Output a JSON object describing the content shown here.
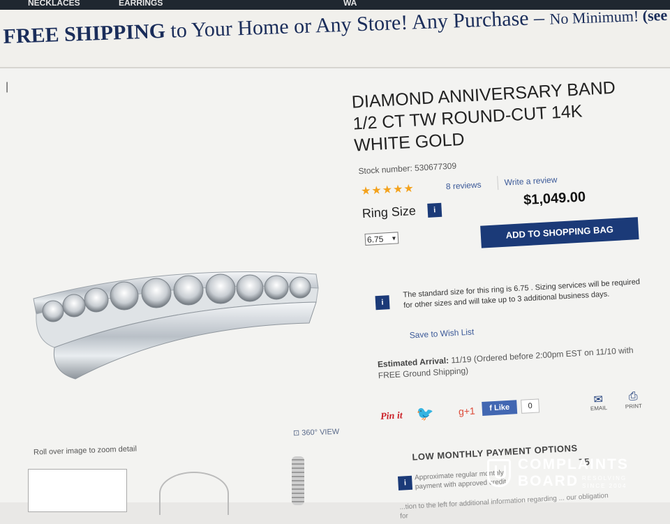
{
  "nav": {
    "items": [
      "NECKLACES",
      "EARRINGS",
      "WA"
    ]
  },
  "promo": {
    "bold": "FREE SHIPPING",
    "rest": " to Your Home or Any Store! Any Purchase – ",
    "small": "No Minimum! ",
    "see": "(see"
  },
  "product": {
    "title": "DIAMOND ANNIVERSARY BAND 1/2 CT TW ROUND-CUT 14K WHITE GOLD",
    "stock": "Stock number: 530677309",
    "rating": 5,
    "stars": "★★★★★",
    "reviews": "8 reviews",
    "write_review": "Write a review",
    "ring_size_label": "Ring Size",
    "price": "$1,049.00",
    "selected_size": "6.75",
    "add_to_bag": "ADD TO SHOPPING BAG",
    "size_notice": "The standard size for this ring is 6.75 . Sizing services will be required for other sizes and will take up to 3 additional business days.",
    "wish_list": "Save to Wish List",
    "arrival_label": "Estimated Arrival:",
    "arrival_text": " 11/19 (Ordered before 2:00pm EST on 11/10 with FREE Ground Shipping)"
  },
  "social": {
    "pinit": "Pin it",
    "gplus": "g+1",
    "fb_like": "Like",
    "fb_count": "0",
    "email": "EMAIL",
    "print": "PRINT"
  },
  "gallery": {
    "view360": "360° VIEW",
    "rollover": "Roll over image to zoom detail"
  },
  "payment": {
    "heading": "LOW MONTHLY PAYMENT OPTIONS",
    "approx": "Approximate regular monthly payment with approved credit",
    "amount": "75",
    "note": "...tion to the left for additional information regarding ... our obligation for"
  },
  "info_icon": "i",
  "watermark": {
    "line1": "COMPLAINTS",
    "line2": "BOARD",
    "tag1": "RESOLVING",
    "tag2": "SINCE 2004"
  },
  "colors": {
    "brand_navy": "#1b3a78",
    "star": "#f3a21c",
    "link": "#3b5998"
  }
}
